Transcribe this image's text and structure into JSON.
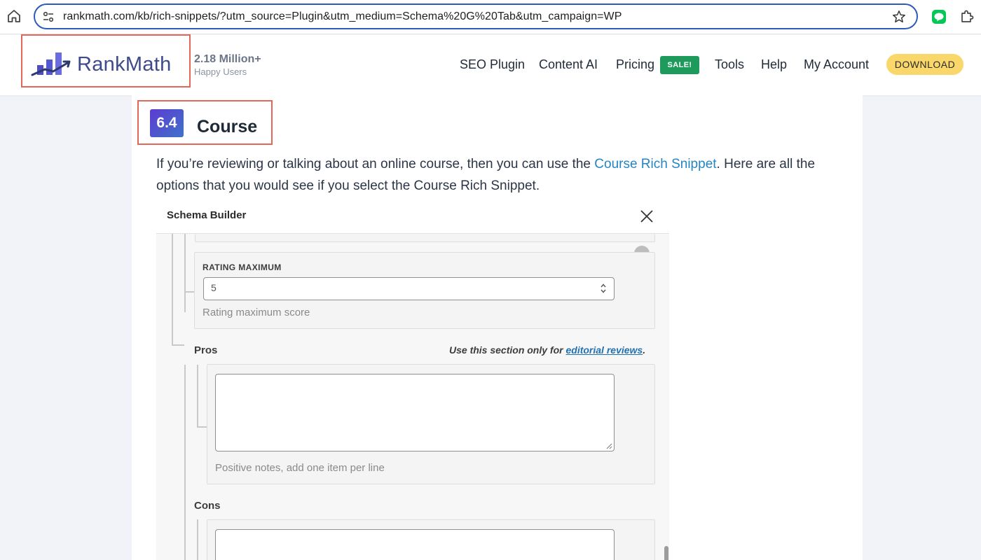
{
  "browser": {
    "url": "rankmath.com/kb/rich-snippets/?utm_source=Plugin&utm_medium=Schema%20G%20Tab&utm_campaign=WP",
    "icons": [
      "home-icon",
      "site-settings-icon",
      "bookmark-star-icon",
      "line-extension-icon",
      "extensions-puzzle-icon"
    ]
  },
  "header": {
    "logo_text": "RankMath",
    "users_count": "2.18 Million+",
    "users_label": "Happy Users",
    "nav": {
      "seo_plugin": "SEO Plugin",
      "content_ai": "Content AI",
      "pricing": "Pricing",
      "sale": "SALE!",
      "tools": "Tools",
      "help": "Help",
      "my_account": "My Account",
      "download": "DOWNLOAD"
    },
    "colors": {
      "sale": "#1e9a5c",
      "download": "#fad76a",
      "highlight": "#e3665a"
    }
  },
  "article": {
    "section_number": "6.4",
    "section_title": "Course",
    "para_before": "If you’re reviewing or talking about an online course, then you can use the ",
    "para_link": "Course Rich Snippet",
    "para_after": ". Here are all the options that you would see if you select the Course Rich Snippet."
  },
  "schema_builder": {
    "title": "Schema Builder",
    "rating_max_label": "RATING MAXIMUM",
    "rating_max_value": "5",
    "rating_max_help": "Rating maximum score",
    "pros_label": "Pros",
    "editorial_note_prefix": "Use this section only for ",
    "editorial_note_link": "editorial reviews",
    "editorial_note_suffix": ".",
    "pros_help": "Positive notes, add one item per line",
    "cons_label": "Cons"
  }
}
